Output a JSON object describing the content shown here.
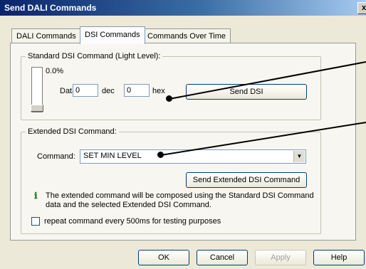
{
  "window": {
    "title": "Send DALI Commands",
    "close_label": "x"
  },
  "tabs": [
    {
      "label": "DALI Commands",
      "active": false
    },
    {
      "label": "DSI Commands",
      "active": true
    },
    {
      "label": "Commands Over Time",
      "active": false
    }
  ],
  "standard": {
    "legend": "Standard DSI Command (Light Level):",
    "level_readout": "0.0%",
    "level_fraction": 0,
    "data_label": "Data:",
    "dec_value": "0",
    "dec_label": "dec",
    "hex_value": "0",
    "hex_label": "hex",
    "send_button": "Send DSI"
  },
  "extended": {
    "legend": "Extended DSI Command:",
    "command_label": "Command:",
    "command_value": "SET MIN LEVEL",
    "send_button": "Send Extended DSI Command",
    "info_line1": "The extended command will be composed using the Standard DSI Command",
    "info_line2": "data and the selected Extended DSI Command.",
    "repeat_label": "repeat command every 500ms for testing purposes",
    "repeat_checked": false
  },
  "buttons": {
    "ok": "OK",
    "cancel": "Cancel",
    "apply": "Apply",
    "help": "Help"
  },
  "icons": {
    "info": "info-icon",
    "dropdown": "chevron-down-icon"
  }
}
